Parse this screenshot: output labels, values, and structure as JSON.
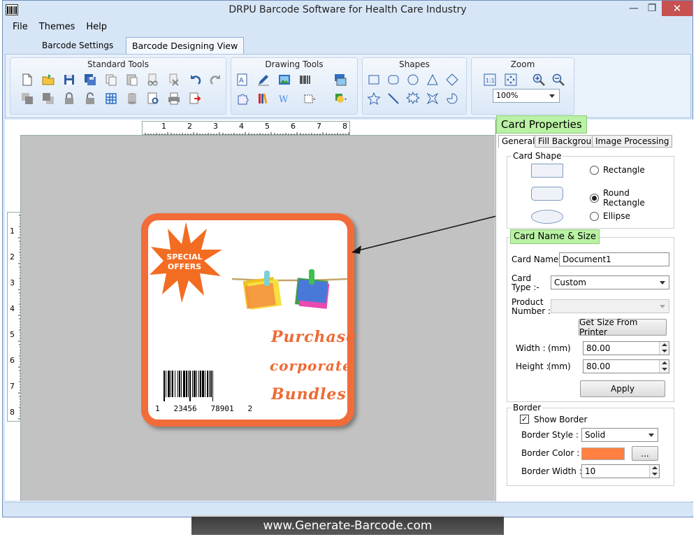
{
  "window": {
    "title": "DRPU Barcode Software for Health Care Industry",
    "minimize": "—",
    "maximize": "❐",
    "close": "✕"
  },
  "menu": [
    "File",
    "Themes",
    "Help"
  ],
  "tabs": {
    "settings": "Barcode Settings",
    "designing": "Barcode Designing View"
  },
  "ribbon": {
    "standard_tools": "Standard Tools",
    "drawing_tools": "Drawing Tools",
    "shapes": "Shapes",
    "zoom": "Zoom",
    "zoom_value": "100%"
  },
  "rulers": {
    "horizontal": [
      "1",
      "2",
      "3",
      "4",
      "5",
      "6",
      "7",
      "8"
    ],
    "vertical": [
      "1",
      "2",
      "3",
      "4",
      "5",
      "6",
      "7",
      "8"
    ]
  },
  "card": {
    "badge_line1": "SPECIAL",
    "badge_line2": "OFFERS",
    "text_line1": "Purchase",
    "text_line2": "corporate",
    "text_line3": "Bundles",
    "barcode_digits": "1   23456   78901   2",
    "border_color": "#f26c3a"
  },
  "panel": {
    "title": "Card Properties",
    "tabs": [
      "General",
      "Fill Background",
      "Image Processing"
    ],
    "card_shape_label": "Card Shape",
    "shape_options": [
      "Rectangle",
      "Round Rectangle",
      "Ellipse"
    ],
    "selected_shape": "Round Rectangle",
    "name_size_label": "Card  Name & Size",
    "card_name_label": "Card Name :",
    "card_name_value": "Document1",
    "card_type_label_1": "Card",
    "card_type_label_2": "Type :-",
    "card_type_value": "Custom",
    "product_label_1": "Product",
    "product_label_2": "Number :-",
    "get_size_button": "Get Size From Printer",
    "width_label": "Width :",
    "height_label": "Height :",
    "unit": "(mm)",
    "width_value": "80.00",
    "height_value": "80.00",
    "apply_button": "Apply",
    "border_label": "Border",
    "show_border_label": "Show Border",
    "show_border_checked": true,
    "border_style_label": "Border Style :",
    "border_style_value": "Solid",
    "border_color_label": "Border Color :",
    "border_color_value": "#ff8040",
    "ellipsis_button": "...",
    "border_width_label": "Border Width :",
    "border_width_value": "10"
  },
  "footer": {
    "banner": "www.Generate-Barcode.com"
  }
}
